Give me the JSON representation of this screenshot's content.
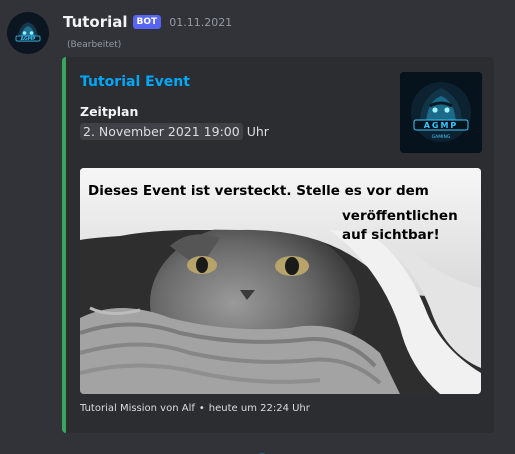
{
  "message": {
    "author": "Tutorial",
    "badge": "BOT",
    "timestamp": "01.11.2021",
    "edited": "(Bearbeitet)",
    "avatar_icon": "gorilla-logo-icon"
  },
  "embed": {
    "accent_color": "#3ba55d",
    "title": "Tutorial Event",
    "field": {
      "name": "Zeitplan",
      "date": "2. November 2021 19:00",
      "suffix": "Uhr"
    },
    "thumbnail_icon": "gorilla-logo-icon",
    "image": {
      "line1": "Dieses Event ist versteckt. Stelle es vor dem",
      "line2": "veröffentlichen",
      "line3": "auf sichtbar!",
      "description_icon": "cat-under-blanket-photo"
    },
    "footer": {
      "author": "Tutorial Mission von Alf",
      "separator": "•",
      "time": "heute um 22:24 Uhr"
    }
  },
  "colors": {
    "background": "#313338",
    "embed_bg": "#2b2d31",
    "title": "#00a8fc",
    "badge": "#5865f2"
  }
}
